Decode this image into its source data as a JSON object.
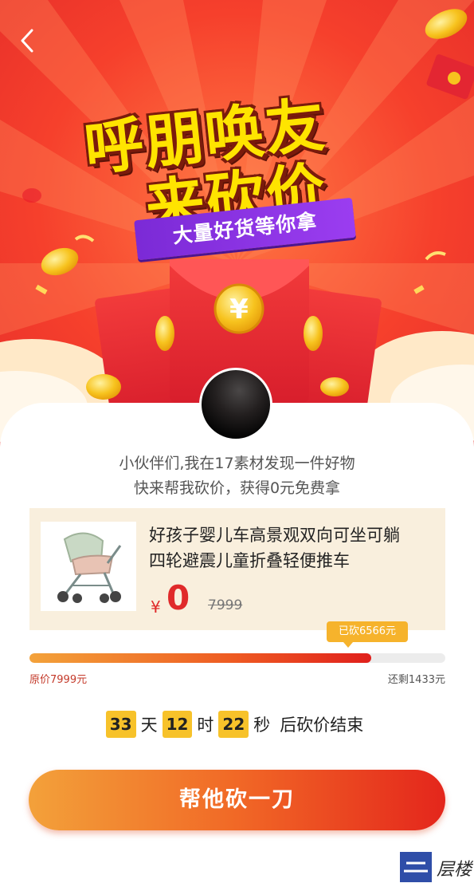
{
  "nav": {
    "back_icon": "chevron-left-icon"
  },
  "banner": {
    "title_line1": "呼朋唤友",
    "title_line2": "来砍价",
    "ribbon_text": "大量好货等你拿",
    "coin_symbol": "¥"
  },
  "intro": {
    "line1": "小伙伴们,我在17素材发现一件好物",
    "line2": "快来帮我砍价，获得0元免费拿"
  },
  "product": {
    "name_line1": "好孩子婴儿车高景观双向可坐可躺",
    "name_line2": "四轮避震儿童折叠轻便推车",
    "currency": "¥",
    "price_now": "0",
    "price_original": "7999",
    "image_icon": "stroller-icon"
  },
  "progress": {
    "cut_tag": "已砍6566元",
    "fraction_cut": 0.821,
    "original_label": "原价7999元",
    "remaining_label": "还剩1433元"
  },
  "countdown": {
    "days": "33",
    "days_unit": "天",
    "hours": "12",
    "hours_unit": "时",
    "seconds": "22",
    "seconds_unit": "秒",
    "suffix": "后砍价结束"
  },
  "action": {
    "button_label": "帮他砍一刀"
  },
  "watermark": {
    "logo_text": "层楼"
  },
  "colors": {
    "banner_red": "#f6402c",
    "title_yellow": "#ffe400",
    "ribbon_purple": "#8a33e6",
    "price_red": "#e02a2a",
    "product_bg": "#f9efdd",
    "accent_orange": "#f16826"
  }
}
